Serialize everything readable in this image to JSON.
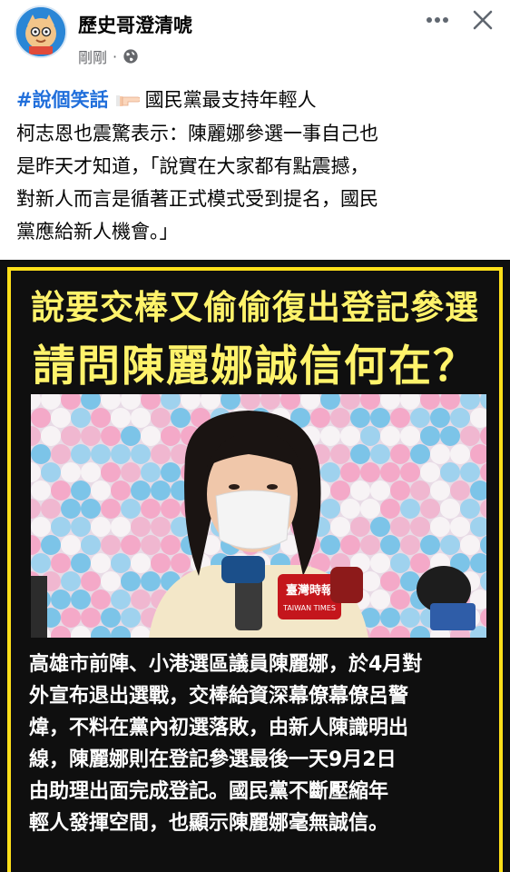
{
  "post": {
    "page_name": "歷史哥澄清唬",
    "time": "剛剛",
    "separator": "·",
    "privacy_icon": "globe-icon",
    "text_lines": [
      {
        "hashtag": "#說個笑話",
        "rest": "國民黨最支持年輕人"
      },
      "柯志恩也震驚表示：陳麗娜參選一事自己也",
      "是昨天才知道，「說實在大家都有點震撼，",
      "對新人而言是循著正式模式受到提名，國民",
      "黨應給新人機會。」"
    ]
  },
  "poster": {
    "headline_1": "說要交棒又偷偷復出登記參選",
    "headline_2": "請問陳麗娜誠信何在？",
    "mic_logo_text": "臺灣時報",
    "mic_logo_subtext": "TAIWAN TIMES",
    "body_lines": [
      "高雄市前陣、小港選區議員陳麗娜，於4月對",
      "外宣布退出選戰，交棒給資深幕僚幕僚呂警",
      "煒，不料在黨內初選落敗，由新人陳識明出",
      "線，陳麗娜則在登記參選最後一天9月2日",
      "由助理出面完成登記。國民黨不斷壓縮年",
      "輕人發揮空間，也顯示陳麗娜毫無誠信。"
    ]
  },
  "colors": {
    "hashtag": "#216fdb",
    "headline": "#fff36b",
    "border": "#ffe01a",
    "poster_bg": "#0f0f0f"
  }
}
